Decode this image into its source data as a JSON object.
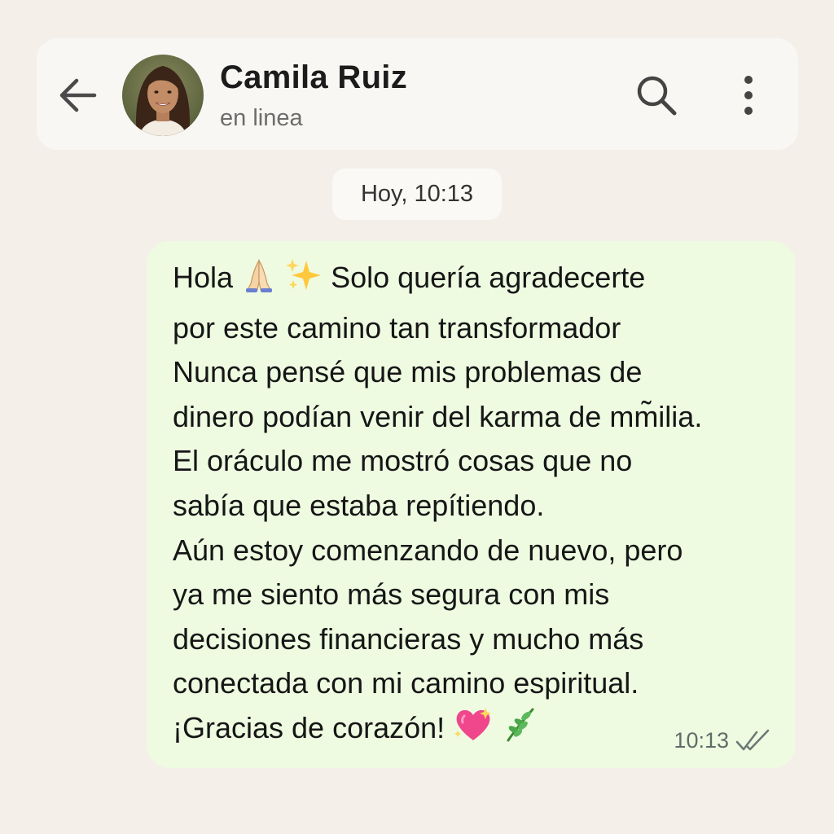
{
  "header": {
    "contact_name": "Camila Ruiz",
    "status": "en linea",
    "icons": {
      "back": "arrow-left-icon",
      "search": "search-icon",
      "menu": "more-vertical-icon"
    }
  },
  "chat": {
    "date_chip": "Hoy, 10:13",
    "message": {
      "lines": [
        {
          "text": "Hola ",
          "after": " Solo quería agradecerte",
          "emoji_mid": [
            "pray-emoji",
            "sparkles-emoji"
          ]
        },
        {
          "text": "por este camino tan transformador"
        },
        {
          "text": "Nunca pensé que mis problemas de"
        },
        {
          "text": "dinero podían venir del karma de mm̃ilia."
        },
        {
          "text": "El oráculo me mostró cosas que no"
        },
        {
          "text": "sabía que estaba repítiendo."
        },
        {
          "text": "Aún estoy comenzando de nuevo, pero"
        },
        {
          "text": "ya me siento más segura con mis"
        },
        {
          "text": "decisiones financieras y mucho más"
        },
        {
          "text": "conectada con mi camino espiritual."
        },
        {
          "text": "¡Gracias de corazón! ",
          "emoji_end": [
            "sparkling-heart-emoji",
            "herb-emoji"
          ]
        }
      ],
      "time": "10:13",
      "status_icon": "double-check-icon"
    }
  },
  "colors": {
    "background": "#f4efe9",
    "header_bg": "#f9f7f4",
    "bubble_bg": "#eefbe1",
    "text": "#161616",
    "meta": "#5f6d69"
  }
}
